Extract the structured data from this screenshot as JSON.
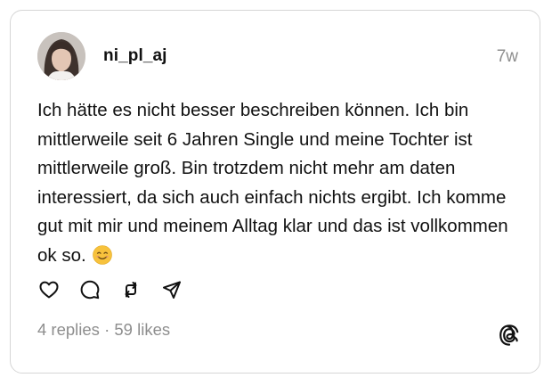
{
  "post": {
    "username": "ni_pl_aj",
    "timestamp": "7w",
    "text": "Ich hätte es nicht besser beschreiben können. Ich bin mittlerweile seit 6 Jahren Single und meine Tochter ist mittlerweile groß. Bin trotzdem nicht mehr am daten interessiert, da sich auch einfach nichts ergibt. Ich komme gut mit mir und meinem Alltag klar und das ist vollkommen ok so.",
    "emoji": "smiling-face-with-smiling-eyes"
  },
  "actions": {
    "icons": [
      "heart-icon",
      "comment-icon",
      "repost-icon",
      "share-icon"
    ]
  },
  "stats": {
    "replies": "4 replies",
    "separator": "·",
    "likes": "59 likes"
  },
  "branding": {
    "logo": "threads-logo-icon"
  },
  "colors": {
    "text": "#111111",
    "muted": "#8e8e8e",
    "border": "#d6d6d6",
    "emoji": "#f7c23c"
  }
}
